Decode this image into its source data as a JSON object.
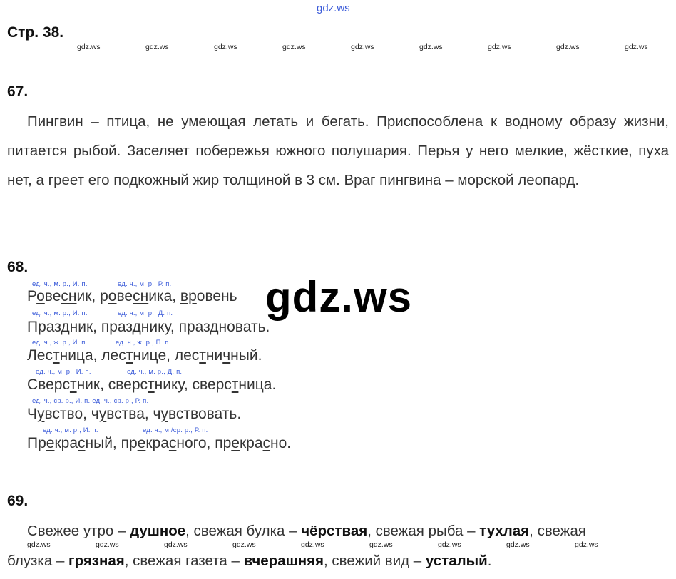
{
  "top_watermark": "gdz.ws",
  "page_ref": "Стр. 38.",
  "small_watermark": "gdz.ws",
  "center_watermark": "gdz.ws",
  "ex67": {
    "number": "67.",
    "text": "Пингвин – птица, не умеющая летать и бегать. Приспособлена к водному образу жизни, питается рыбой. Заселяет побережья южного полушария. Перья у него мелкие, жёсткие, пуха нет, а греет его подкожный жир толщиной в 3 см. Враг пингвина – морской леопард."
  },
  "ex68": {
    "number": "68.",
    "rows": [
      {
        "ann1": "ед. ч., м. р., И. п.",
        "ann2": "ед. ч., м. р., Р. п.",
        "w1": [
          "Р",
          "о",
          "в",
          "е",
          "сн",
          "ик"
        ],
        "w2": [
          "р",
          "о",
          "в",
          "е",
          "сн",
          "ика"
        ],
        "w3": [
          "",
          "вр",
          "о",
          "вень"
        ],
        "end": "."
      },
      {
        "ann1": "ед. ч., м. р., И. п.",
        "ann2": "ед. ч., м. р., Д. п."
      },
      {
        "ann1": "ед. ч., ж. р., И. п.",
        "ann2": "ед. ч., ж. р., П. п."
      },
      {
        "ann1": "ед. ч., м. р., И. п.",
        "ann2": "ед. ч., м. р., Д. п."
      },
      {
        "ann1": "ед. ч., ср. р., И. п. ед. ч., ср. р., Р. п."
      },
      {
        "ann1": "ед. ч., м. р., И. п.",
        "ann2": "ед. ч., м./ср. р., Р. п."
      }
    ],
    "lines": [
      "Ровесник, ровесника, вровень.",
      "Праздник, празднику, праздновать.",
      "Лестница, лестнице, лестничный.",
      "Сверстник, сверстнику, сверстница.",
      "Чувство, чувства, чувствовать.",
      "Прекрасный, прекрасного, прекрасно."
    ]
  },
  "ex69": {
    "number": "69.",
    "line1": {
      "a": "Свежее утро – ",
      "b": "душное",
      "c": ", свежая булка – ",
      "d": "чёрствая",
      "e": ", свежая рыба – ",
      "f": "тухлая",
      "g": ", свежая"
    },
    "line2": {
      "a": "блузка – ",
      "b": "грязная",
      "c": ", свежая газета – ",
      "d": "вчерашняя",
      "e": ", свежий вид – ",
      "f": "усталый",
      "g": "."
    }
  }
}
